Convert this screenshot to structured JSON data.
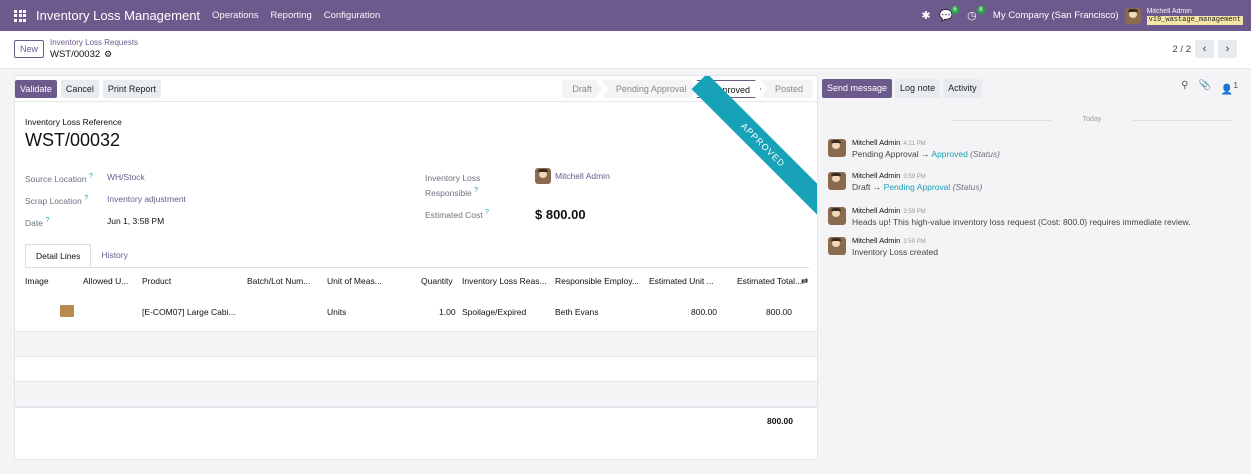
{
  "topbar": {
    "app_title": "Inventory Loss Management",
    "menus": [
      "Operations",
      "Reporting",
      "Configuration"
    ],
    "messages_badge": "6",
    "activities_badge": "8",
    "company": "My Company (San Francisco)",
    "user_name": "Mitchell Admin",
    "database": "v19_wastage_management"
  },
  "control_panel": {
    "new_label": "New",
    "breadcrumb_parent": "Inventory Loss Requests",
    "record_name": "WST/00032",
    "pager": "2 / 2"
  },
  "statusbar": {
    "buttons": [
      "Validate",
      "Cancel",
      "Print Report"
    ],
    "stages": [
      "Draft",
      "Pending Approval",
      "Approved",
      "Posted"
    ],
    "active_stage": "Approved"
  },
  "ribbon": "APPROVED",
  "form": {
    "reference_label": "Inventory Loss Reference",
    "reference": "WST/00032",
    "source_location_label": "Source Location",
    "source_location": "WH/Stock",
    "scrap_location_label": "Scrap Location",
    "scrap_location": "Inventory adjustment",
    "date_label": "Date",
    "date": "Jun 1, 3:58 PM",
    "responsible_label_1": "Inventory Loss",
    "responsible_label_2": "Responsible",
    "responsible": "Mitchell Admin",
    "estimated_cost_label": "Estimated Cost",
    "estimated_cost": "$ 800.00",
    "help_mark": "?"
  },
  "tabs": [
    "Detail Lines",
    "History"
  ],
  "table": {
    "headers": [
      "Image",
      "Allowed U...",
      "Product",
      "Batch/Lot Num...",
      "Unit of Meas...",
      "Quantity",
      "Inventory Loss Reas...",
      "Responsible Employ...",
      "Estimated Unit ...",
      "Estimated Total..."
    ],
    "rows": [
      {
        "product": "[E-COM07] Large Cabi...",
        "uom": "Units",
        "quantity": "1.00",
        "reason": "Spoilage/Expired",
        "employee": "Beth Evans",
        "unit_cost": "800.00",
        "total": "800.00"
      }
    ],
    "grand_total": "800.00"
  },
  "chatter": {
    "buttons": [
      "Send message",
      "Log note",
      "Activity"
    ],
    "followers_count": "1",
    "today_label": "Today",
    "messages": [
      {
        "author": "Mitchell Admin",
        "time": "4:21 PM",
        "from": "Pending Approval",
        "to": "Approved",
        "field": "(Status)"
      },
      {
        "author": "Mitchell Admin",
        "time": "3:59 PM",
        "from": "Draft",
        "to": "Pending Approval",
        "field": "(Status)"
      },
      {
        "author": "Mitchell Admin",
        "time": "3:59 PM",
        "text": "Heads up! This high-value inventory loss request (Cost: 800.0) requires immediate review."
      },
      {
        "author": "Mitchell Admin",
        "time": "3:59 PM",
        "text": "Inventory Loss created"
      }
    ]
  }
}
